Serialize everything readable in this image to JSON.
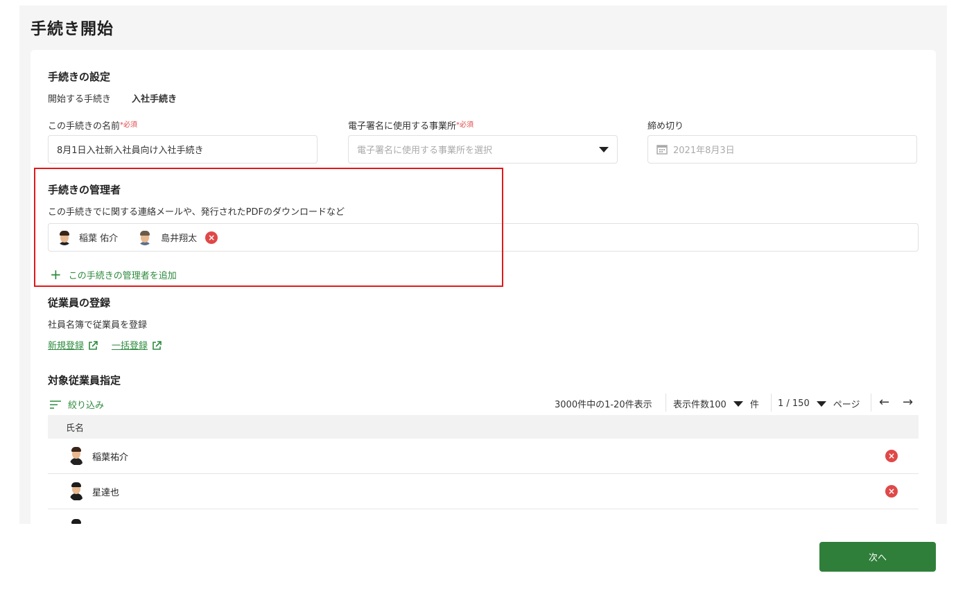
{
  "page_title": "手続き開始",
  "settings": {
    "heading": "手続きの設定",
    "start_label": "開始する手続き",
    "start_value": "入社手続き",
    "name_label": "この手続きの名前",
    "required_mark": "*必須",
    "name_value": "8月1日入社新入社員向け入社手続き",
    "office_label": "電子署名に使用する事業所",
    "office_placeholder": "電子署名に使用する事業所を選択",
    "deadline_label": "締め切り",
    "deadline_value": "2021年8月3日"
  },
  "managers": {
    "heading": "手続きの管理者",
    "description": "この手続きでに関する連絡メールや、発行されたPDFのダウンロードなど",
    "people": [
      "稲葉 佑介",
      "島井翔太"
    ],
    "add_label": "この手続きの管理者を追加"
  },
  "employee_registration": {
    "heading": "従業員の登録",
    "description": "社員名簿で従業員を登録",
    "new_link": "新規登録",
    "bulk_link": "一括登録"
  },
  "target": {
    "heading": "対象従業員指定",
    "filter_label": "絞り込み",
    "count_text": "3000件中の1-20件表示",
    "per_page_label": "表示件数100",
    "per_page_unit": "件",
    "page_value": "1 / 150",
    "page_unit": "ページ",
    "column_name": "氏名",
    "rows": [
      "稲葉祐介",
      "星達也"
    ]
  },
  "next_button": "次へ",
  "colors": {
    "accent_green": "#2c8a3d",
    "button_green": "#2f7f3a",
    "danger_red": "#e04848",
    "highlight_red": "#e01818"
  }
}
